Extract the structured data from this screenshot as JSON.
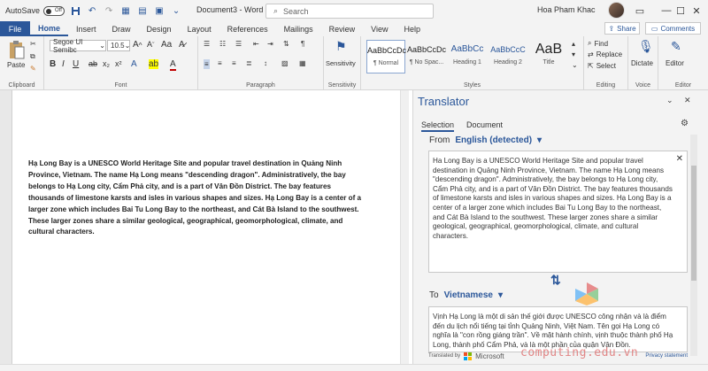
{
  "titlebar": {
    "autosave_label": "AutoSave",
    "autosave_state": "Off",
    "doc_title": "Document3  -  Word",
    "search_placeholder": "Search",
    "user_name": "Hoa Pham Khac"
  },
  "tabs": [
    "File",
    "Home",
    "Insert",
    "Draw",
    "Design",
    "Layout",
    "References",
    "Mailings",
    "Review",
    "View",
    "Help"
  ],
  "active_tab": "Home",
  "share_label": "Share",
  "comments_label": "Comments",
  "ribbon": {
    "clipboard": {
      "paste_label": "Paste",
      "group_label": "Clipboard"
    },
    "font": {
      "font_name": "Segoe UI Semibc",
      "font_size": "10.5",
      "group_label": "Font"
    },
    "paragraph": {
      "group_label": "Paragraph"
    },
    "sensitivity": {
      "label": "Sensitivity",
      "group_label": "Sensitivity"
    },
    "styles": {
      "items": [
        {
          "preview": "AaBbCcDc",
          "name": "¶ Normal"
        },
        {
          "preview": "AaBbCcDc",
          "name": "¶ No Spac..."
        },
        {
          "preview": "AaBbCc",
          "name": "Heading 1"
        },
        {
          "preview": "AaBbCcC",
          "name": "Heading 2"
        },
        {
          "preview": "AaB",
          "name": "Title"
        }
      ],
      "group_label": "Styles"
    },
    "editing": {
      "find": "Find",
      "replace": "Replace",
      "select": "Select",
      "group_label": "Editing"
    },
    "voice": {
      "dictate": "Dictate",
      "group_label": "Voice"
    },
    "editor": {
      "label": "Editor",
      "group_label": "Editor"
    }
  },
  "document": {
    "body": "Hạ Long Bay is a UNESCO World Heritage Site and popular travel destination in Quảng Ninh Province, Vietnam. The name Hạ Long means \"descending dragon\". Administratively, the bay belongs to Hạ Long city, Cẩm Phả city, and is a part of Vân Đồn District. The bay features thousands of limestone karsts and isles in various shapes and sizes. Hạ Long Bay is a center of a larger zone which includes Bai Tu Long Bay to the northeast, and Cát Bà Island to the southwest. These larger zones share a similar geological, geographical, geomorphological, climate, and cultural characters."
  },
  "translator": {
    "title": "Translator",
    "tabs": [
      "Selection",
      "Document"
    ],
    "from_label": "From",
    "from_lang": "English (detected)",
    "source_text": "Ha Long Bay is a UNESCO World Heritage Site and popular travel destination in Quảng Ninh Province, Vietnam. The name Hạ Long means \"descending dragon\". Administratively, the bay belongs to Hạ Long city, Cẩm Phả city, and is a part of Vân Đồn District. The bay features thousands of limestone karsts and isles in various shapes and sizes. Hạ Long Bay is a center of a larger zone which includes Bai Tu Long Bay to the northeast, and Cát Bà Island to the southwest. These larger zones share a similar geological, geographical, geomorphological, climate, and cultural characters.",
    "to_label": "To",
    "to_lang": "Vietnamese",
    "target_text": "Vịnh Hạ Long là một di sản thế giới được UNESCO công nhận và là điểm đến du lịch nổi tiếng tại tỉnh Quảng Ninh, Việt Nam. Tên gọi Hạ Long có nghĩa là \"con rồng giáng trần\". Về mặt hành chính, vịnh thuộc thành phố Hạ Long, thành phố Cẩm Phả, và là một phần của quận Vân Đồn.",
    "footer_prefix": "Translated by",
    "footer_brand": "Microsoft",
    "privacy": "Privacy statement"
  },
  "watermark": "computing.edu.vn"
}
